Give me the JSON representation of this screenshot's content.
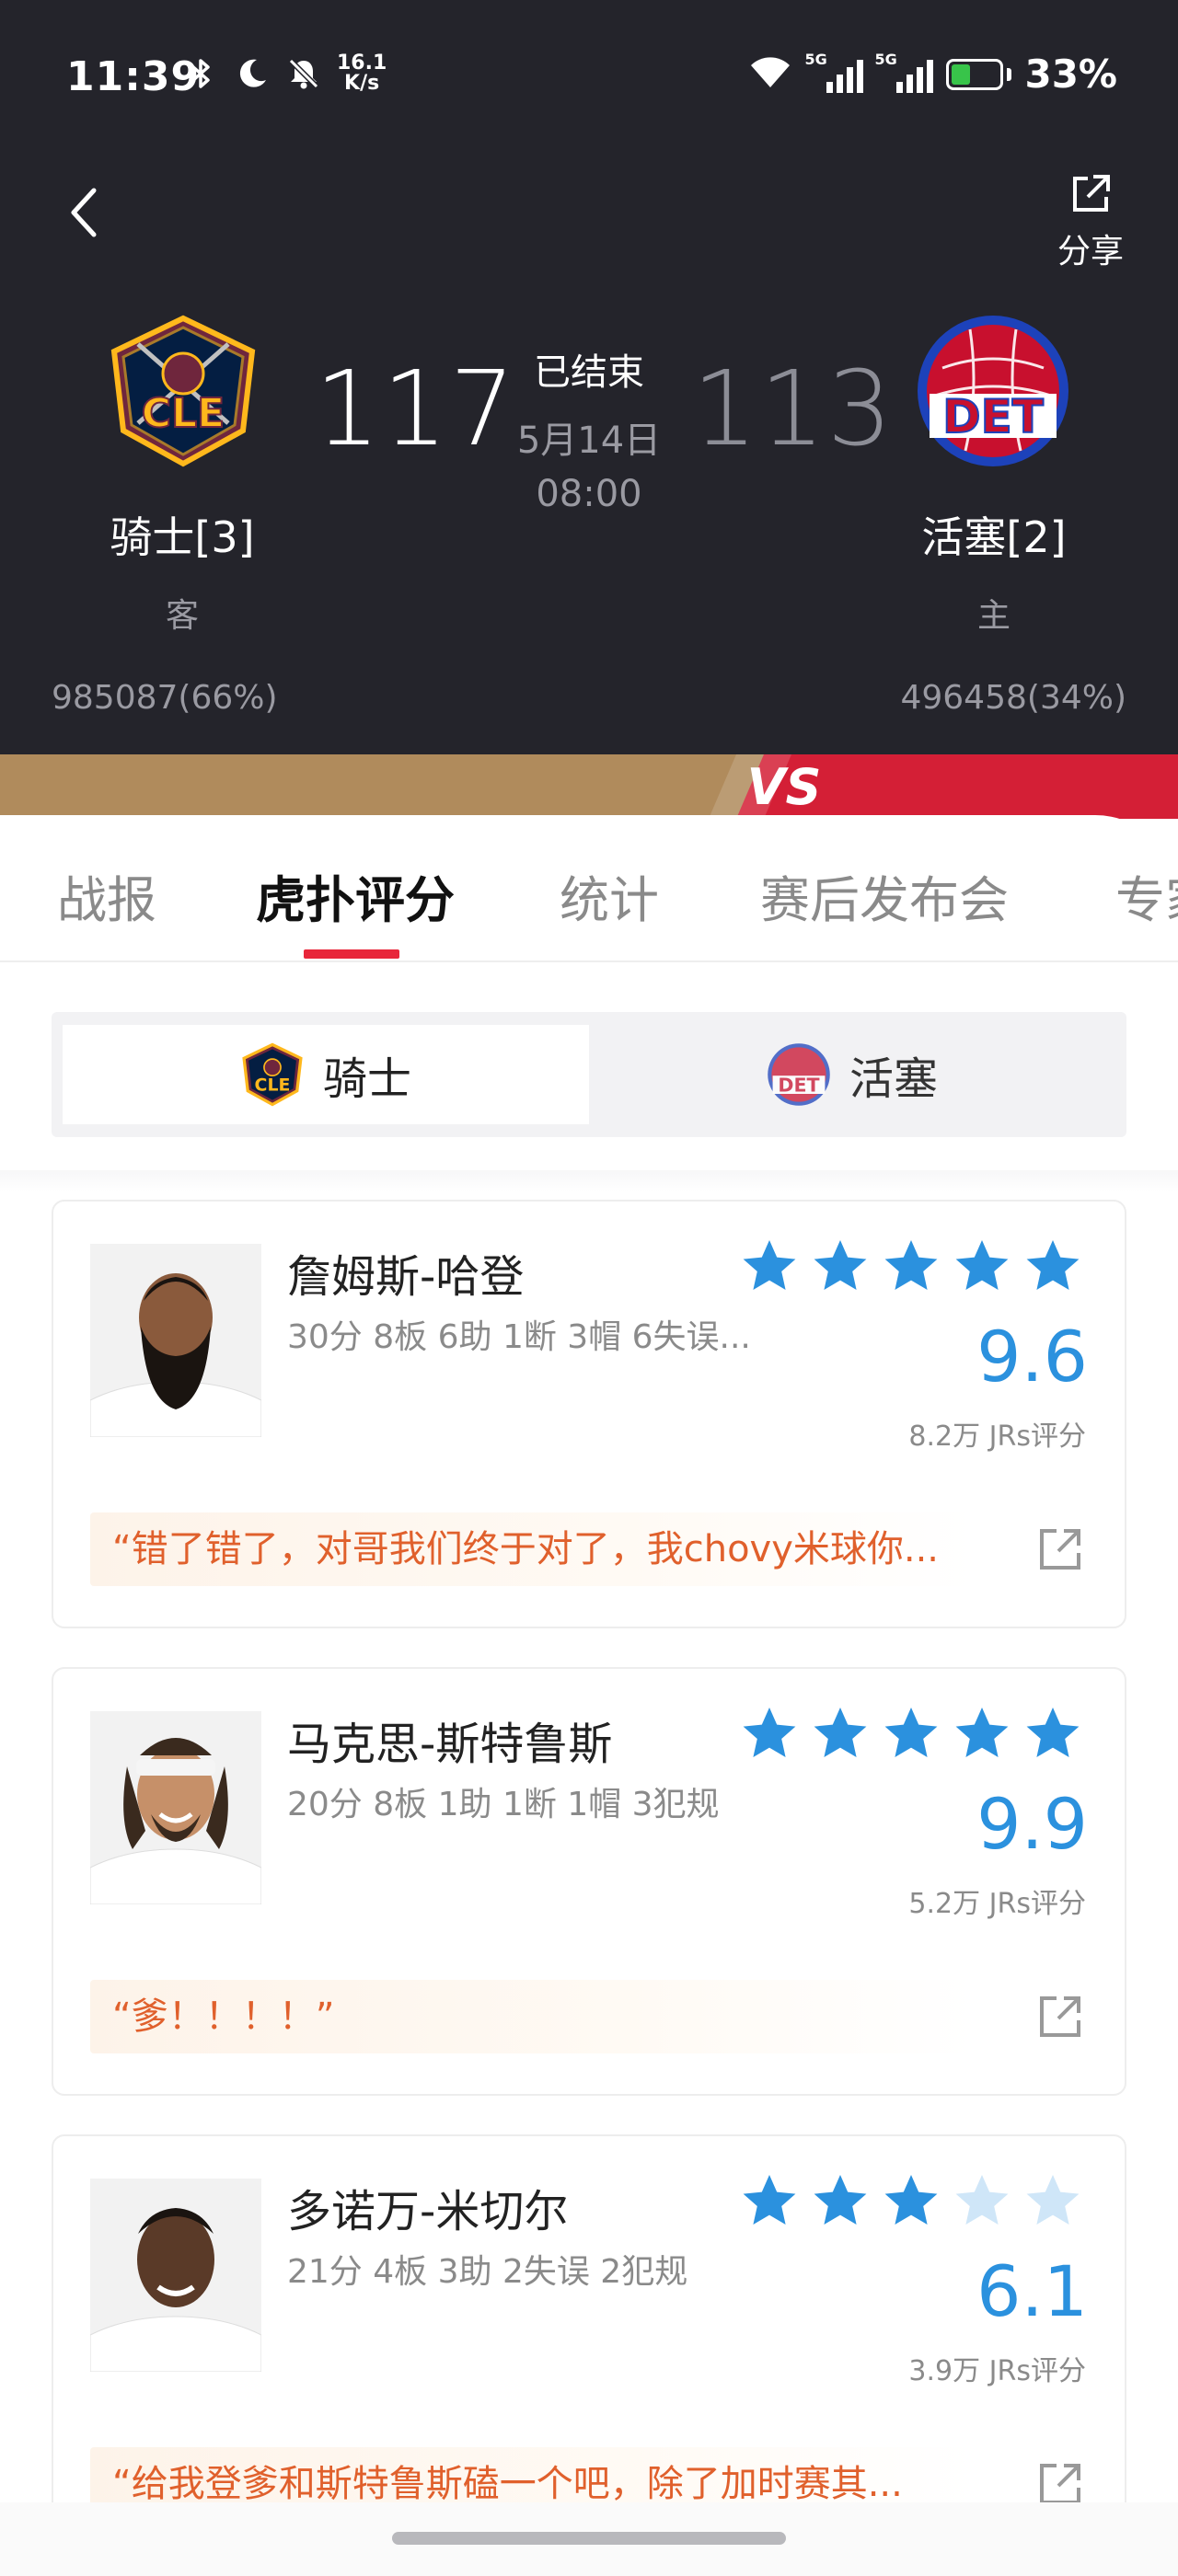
{
  "status_bar": {
    "time": "11:39",
    "net_speed_value": "16.1",
    "net_speed_unit": "K/s",
    "signal_1": "5G",
    "signal_2": "5G",
    "battery": "33%"
  },
  "header": {
    "share_label": "分享",
    "away": {
      "name": "骑士[3]",
      "side": "客",
      "score": "117",
      "votes": "985087(66%)",
      "logo_text": "CLE"
    },
    "home": {
      "name": "活塞[2]",
      "side": "主",
      "score": "113",
      "votes": "496458(34%)",
      "logo_text": "DET"
    },
    "status": "已结束",
    "date": "5月14日",
    "time": "08:00",
    "vs": "VS"
  },
  "tabs": [
    "战报",
    "虎扑评分",
    "统计",
    "赛后发布会",
    "专家"
  ],
  "active_tab": "虎扑评分",
  "team_toggle": {
    "away": "骑士",
    "home": "活塞",
    "selected": "骑士"
  },
  "players": [
    {
      "name": "詹姆斯-哈登",
      "stats": "30分 8板 6助 1断 3帽 6失误...",
      "stars": 5,
      "rating": "9.6",
      "votes": "8.2万 JRs评分",
      "comment": "“错了错了，对哥我们终于对了，我chovy米球你..."
    },
    {
      "name": "马克思-斯特鲁斯",
      "stats": "20分 8板 1助 1断 1帽 3犯规",
      "stars": 5,
      "rating": "9.9",
      "votes": "5.2万 JRs评分",
      "comment": "“爹！！！！”"
    },
    {
      "name": "多诺万-米切尔",
      "stats": "21分 4板 3助 2失误 2犯规",
      "stars": 3,
      "rating": "6.1",
      "votes": "3.9万 JRs评分",
      "comment": "“给我登爹和斯特鲁斯磕一个吧，除了加时赛其..."
    }
  ],
  "colors": {
    "accent_red": "#e8263a",
    "rating_blue": "#2b91de",
    "star_blue": "#2b91de",
    "star_empty": "#cfe6f8",
    "quote_orange": "#e0602c",
    "header_bg": "#24242b",
    "cle_wine": "#6f263d",
    "cle_gold": "#ffb81c",
    "det_red": "#c8102e",
    "det_blue": "#1d42ba"
  },
  "icons": [
    "back-chevron-icon",
    "share-icon",
    "bluetooth-icon",
    "moon-icon",
    "bell-off-icon",
    "wifi-icon",
    "signal-icon",
    "battery-icon",
    "star-icon",
    "open-external-icon"
  ]
}
